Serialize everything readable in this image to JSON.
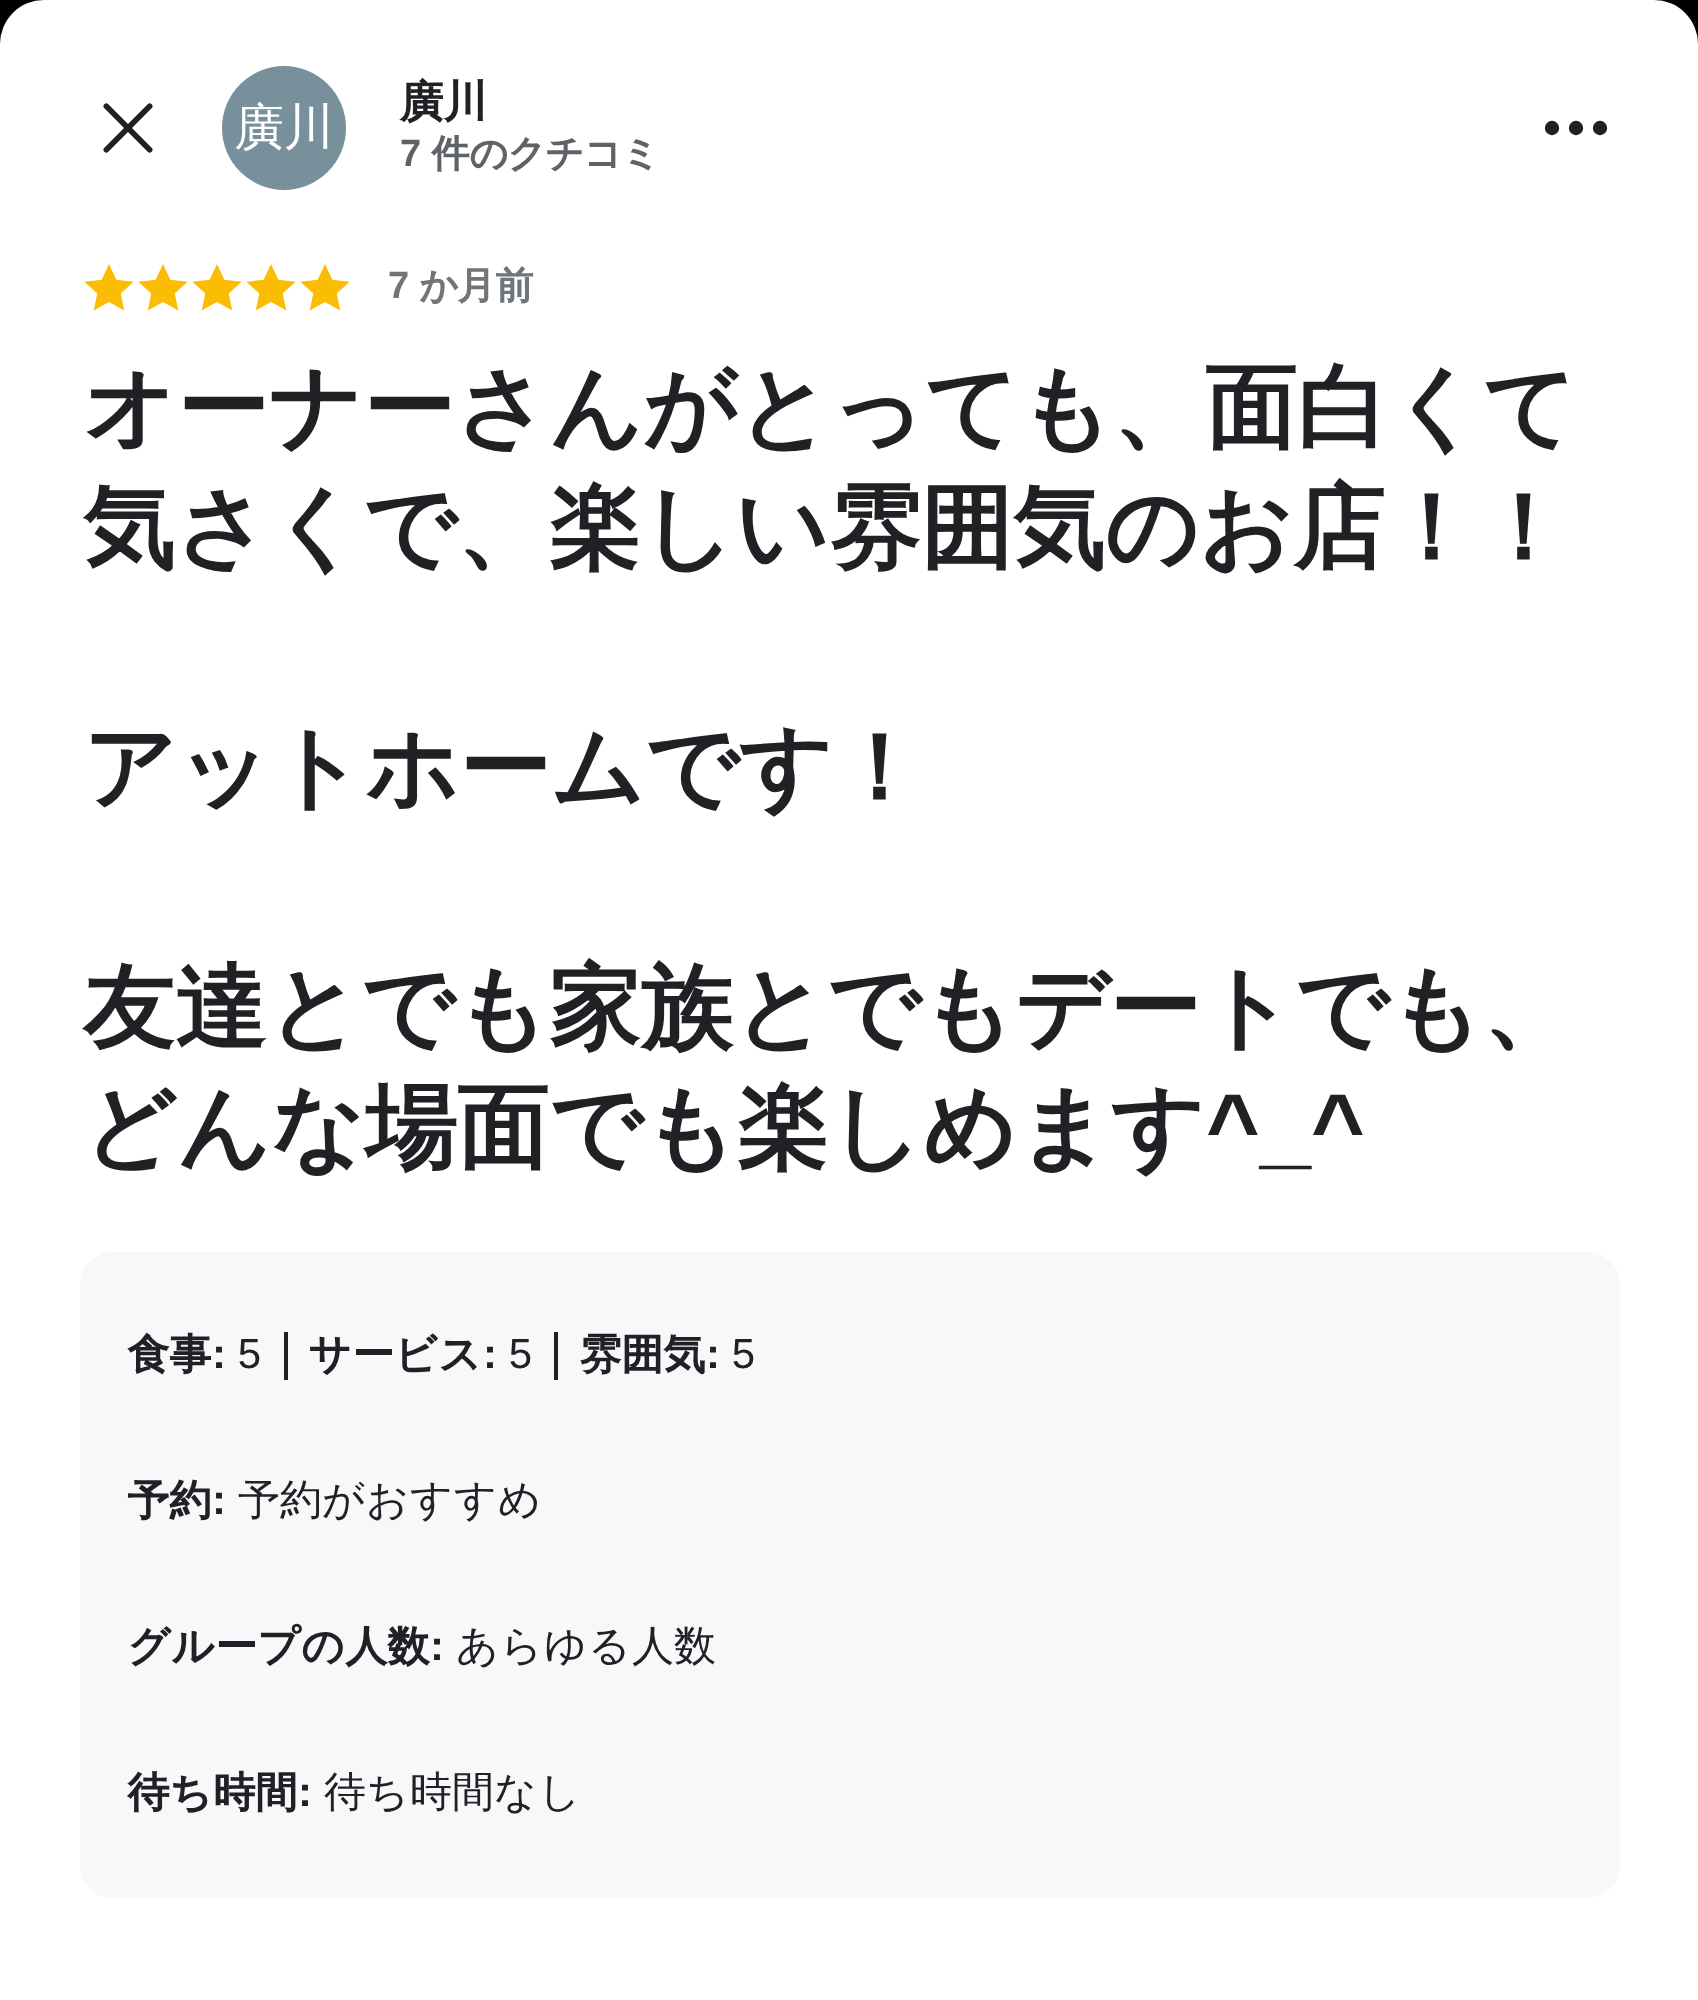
{
  "header": {
    "avatar_text": "廣川",
    "name": "廣川",
    "review_count": "7 件のクチコミ"
  },
  "rating": {
    "stars": 5,
    "time": "7 か月前"
  },
  "review_paragraphs": [
    "オーナーさんがとっても、面白くて気さくで、楽しい雰囲気のお店！！",
    "アットホームです！",
    "友達とでも家族とでもデートでも、どんな場面でも楽しめます^_^"
  ],
  "scores": [
    "**食事:** 5",
    "**サービス:** 5",
    "**雰囲気:** 5"
  ],
  "details": [
    "**予約:** 予約がおすすめ",
    "**グループの人数:** あらゆる人数",
    "**待ち時間:** 待ち時間なし"
  ]
}
